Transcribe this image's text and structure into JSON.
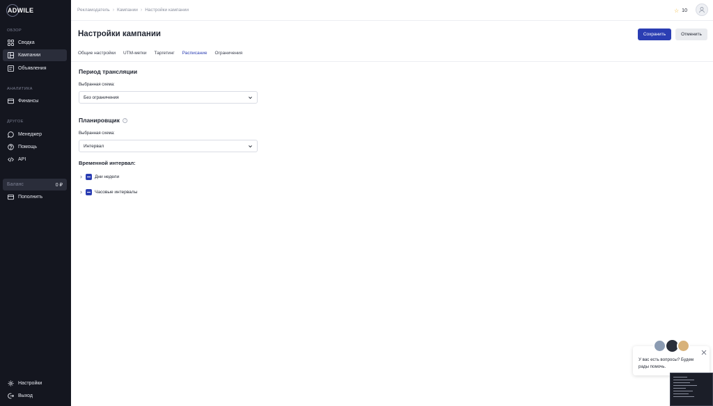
{
  "app": {
    "logo": "ADWILE"
  },
  "sidebar": {
    "sections": [
      {
        "label": "ОБЗОР"
      },
      {
        "label": "АНАЛИТИКА"
      },
      {
        "label": "ДРУГОЕ"
      }
    ],
    "items": [
      {
        "label": "Сводка",
        "icon": "grid-icon"
      },
      {
        "label": "Кампании",
        "icon": "layout-icon",
        "active": true
      },
      {
        "label": "Объявления",
        "icon": "ad-icon"
      },
      {
        "label": "Финансы",
        "icon": "wallet-icon"
      },
      {
        "label": "Менеджер",
        "icon": "chat-icon"
      },
      {
        "label": "Помощь",
        "icon": "help-circle-icon"
      },
      {
        "label": "API",
        "icon": "code-icon"
      },
      {
        "label": "Пополнить",
        "icon": "wallet-icon"
      },
      {
        "label": "Настройки",
        "icon": "gear-icon"
      },
      {
        "label": "Выход",
        "icon": "logout-icon"
      }
    ],
    "balance": {
      "label": "Баланс",
      "value": "0 ₽"
    }
  },
  "breadcrumb": [
    "Рекламодатель",
    "Кампании",
    "Настройки кампании"
  ],
  "header": {
    "stars": "10"
  },
  "page": {
    "title": "Настройки кампании",
    "save_label": "Сохранить",
    "cancel_label": "Отменить"
  },
  "tabs": [
    {
      "label": "Общие настройки"
    },
    {
      "label": "UTM-метки"
    },
    {
      "label": "Таргетинг"
    },
    {
      "label": "Расписание",
      "active": true
    },
    {
      "label": "Ограничения"
    }
  ],
  "broadcast": {
    "title": "Период трансляции",
    "field_label": "Выбранная схема:",
    "value": "Без ограничения"
  },
  "scheduler": {
    "title": "Планировщик",
    "field_label": "Выбранная схема:",
    "value": "Интервал"
  },
  "interval": {
    "title": "Временной интервал:",
    "items": [
      {
        "label": "Дни недели"
      },
      {
        "label": "Часовые интервалы"
      }
    ]
  },
  "chat": {
    "message": "У вас есть вопросы? Будем рады помочь."
  },
  "colors": {
    "accent": "#2b3eb3",
    "sidebar": "#14161f",
    "star": "#f0b429"
  }
}
